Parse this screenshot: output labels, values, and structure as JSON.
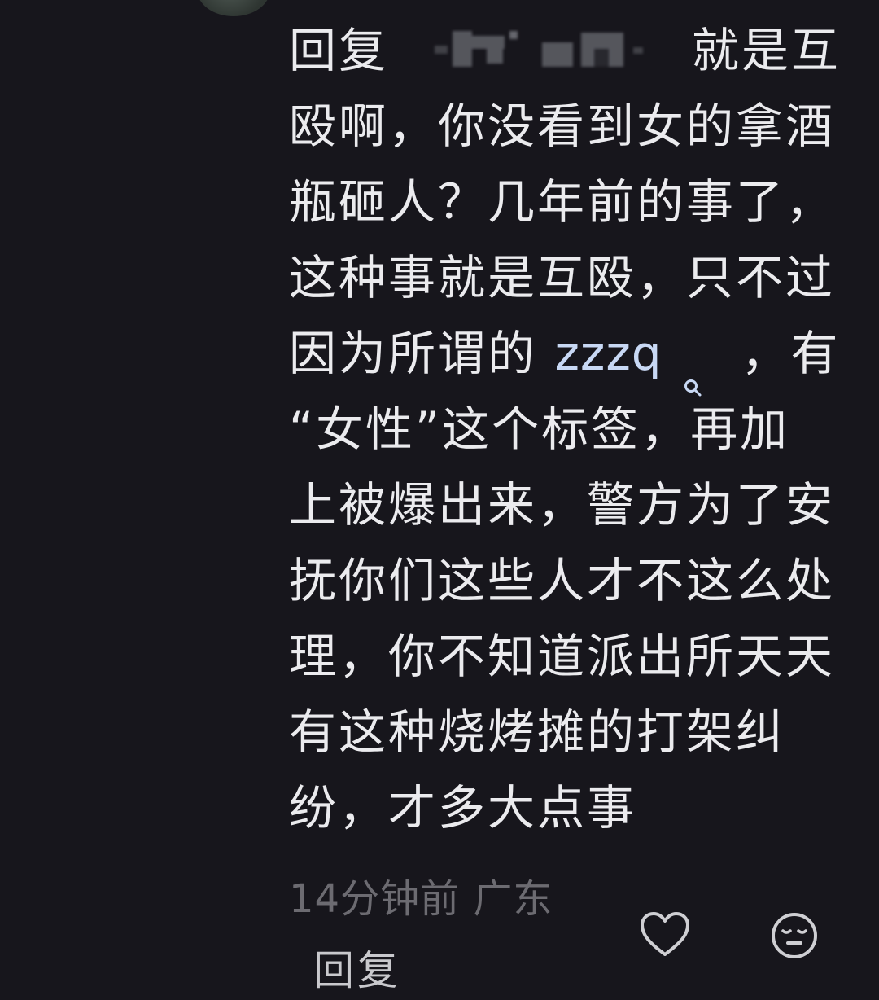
{
  "comment": {
    "reply_prefix": "回复",
    "line1_rest": "就是互",
    "lines": [
      "殴啊，你没看到女的拿酒",
      "瓶砸人？几年前的事了，",
      "这种事就是互殴，只不过"
    ],
    "line5_before": "因为所谓的",
    "link_text": "zzzq",
    "line5_after": "，有",
    "lines_after": [
      "“女性”这个标签，再加",
      "上被爆出来，警方为了安",
      "抚你们这些人才不这么处",
      "理，你不知道派出所天天",
      "有这种烧烤摊的打架纠",
      "纷，才多大点事"
    ]
  },
  "meta": {
    "time_location": "14分钟前 广东"
  },
  "actions": {
    "reply_label": "回复",
    "like_icon": "heart-outline-icon",
    "emoji_icon": "smiley-face-icon"
  },
  "colors": {
    "background": "#17161c",
    "text": "#ebebee",
    "link": "#c8d8f4",
    "meta": "#6c6b71"
  }
}
